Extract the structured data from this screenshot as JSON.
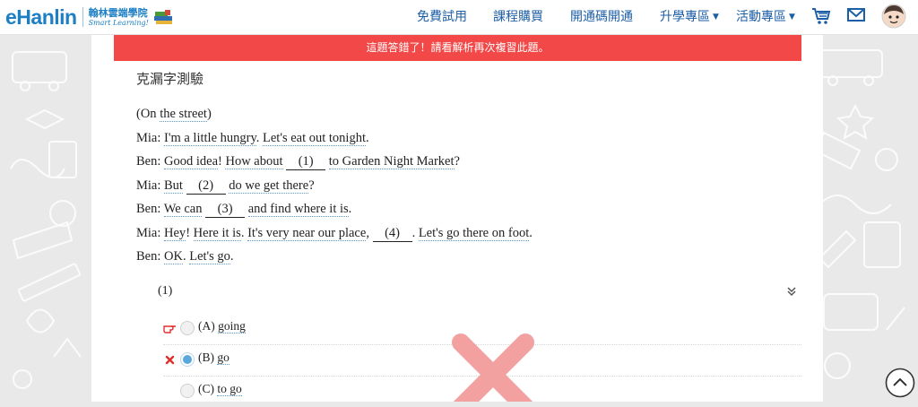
{
  "header": {
    "logo_word": "eHanlin",
    "logo_cn": "翰林雲端學院",
    "logo_en": "Smart Learning!",
    "nav": [
      {
        "label": "免費試用",
        "dropdown": false
      },
      {
        "label": "課程購買",
        "dropdown": false
      },
      {
        "label": "開通碼開通",
        "dropdown": false
      },
      {
        "label": "升學專區",
        "dropdown": true
      },
      {
        "label": "活動專區",
        "dropdown": true
      }
    ],
    "caret": "▼",
    "icons": [
      "cart-icon",
      "mail-icon",
      "avatar"
    ]
  },
  "banner": {
    "text": "這題答錯了！請看解析再次複習此題。",
    "color": "#f24848"
  },
  "section": {
    "title": "克漏字測驗"
  },
  "dialogue": {
    "l0": {
      "a": "(On ",
      "b": "the street",
      "c": ")"
    },
    "l1": {
      "a": "Mia: ",
      "b": "I'm a little hungry",
      "c": ".  ",
      "d": "Let's eat out tonight",
      "e": "."
    },
    "l2": {
      "a": "Ben: ",
      "b": "Good idea",
      "c": "!  ",
      "d": "How about",
      "e": " ",
      "blank": "(1)",
      "f": " ",
      "g": "to Garden Night Market",
      "h": "?"
    },
    "l3": {
      "a": "Mia: ",
      "b": "But",
      "c": " ",
      "blank": "(2)",
      "d": " ",
      "e": "do we get there",
      "f": "?"
    },
    "l4": {
      "a": "Ben: ",
      "b": "We can",
      "c": " ",
      "blank": "(3)",
      "d": " ",
      "e": "and find where it is",
      "f": "."
    },
    "l5": {
      "a": "Mia: ",
      "b": "Hey",
      "c": "!  ",
      "d": "Here it is",
      "e": ".  ",
      "f": "It's very near our place",
      "g": ", ",
      "blank": "(4)",
      "h": ".  ",
      "i": "Let's go there on foot",
      "j": "."
    },
    "l6": {
      "a": "Ben: ",
      "b": "OK",
      "c": ".  ",
      "d": "Let's go",
      "e": "."
    }
  },
  "question": {
    "number": "(1)",
    "options": [
      {
        "label": "(A) ",
        "text": "going",
        "marker": "pointing-hand-icon",
        "selected": false
      },
      {
        "label": "(B) ",
        "text": "go",
        "marker": "wrong-mark-icon",
        "selected": true
      },
      {
        "label": "(C) ",
        "text": "to go",
        "marker": "",
        "selected": false
      }
    ]
  },
  "colors": {
    "brand": "#1d7fc4",
    "nav_text": "#1d5fa6",
    "error": "#f24848",
    "selected_radio": "#5ba8dc",
    "big_x": "#f2a0a0"
  }
}
